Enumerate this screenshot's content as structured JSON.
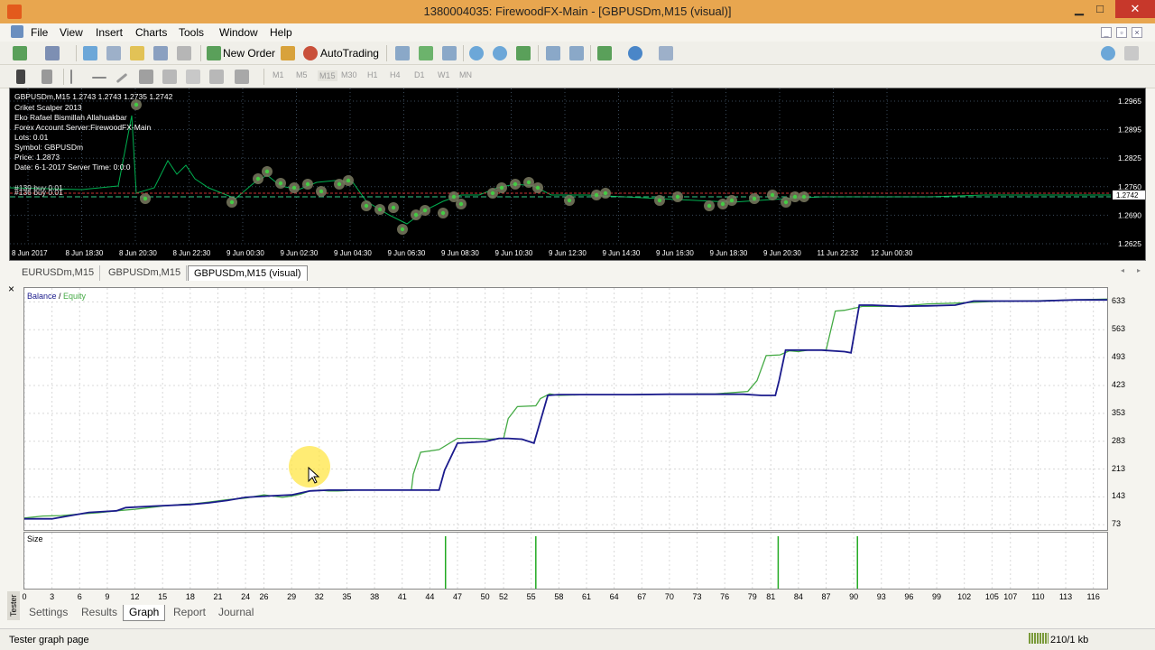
{
  "window": {
    "title": "1380004035: FirewoodFX-Main - [GBPUSDm,M15 (visual)]",
    "minimize": "▁",
    "maximize": "□",
    "close": "✕"
  },
  "menu": [
    "File",
    "View",
    "Insert",
    "Charts",
    "Tools",
    "Window",
    "Help"
  ],
  "toolbar": {
    "new_order": "New Order",
    "autotrading": "AutoTrading",
    "timeframes": [
      "M1",
      "M5",
      "M15",
      "M30",
      "H1",
      "H4",
      "D1",
      "W1",
      "MN"
    ]
  },
  "chart": {
    "header": "GBPUSDm,M15  1.2743 1.2743 1.2735 1.2742",
    "info_lines": [
      "Criket Scalper 2013",
      "Eko Rafael  Bismillah Allahuakbar",
      "Forex Account Server:FirewoodFX-Main",
      "Lots:  0.01",
      "Symbol: GBPUSDm",
      "Price:  1.2873",
      "Date: 6-1-2017  Server Time: 0:0:0"
    ],
    "order_labels": [
      "#139 buy 0.01",
      "#136 buy 0.01"
    ],
    "price_ticks": [
      "1.2965",
      "1.2895",
      "1.2825",
      "1.2760",
      "1.2690",
      "1.2625"
    ],
    "current_price": "1.2742",
    "time_ticks": [
      "8 Jun 2017",
      "8 Jun 18:30",
      "8 Jun 20:30",
      "8 Jun 22:30",
      "9 Jun 00:30",
      "9 Jun 02:30",
      "9 Jun 04:30",
      "9 Jun 06:30",
      "9 Jun 08:30",
      "9 Jun 10:30",
      "9 Jun 12:30",
      "9 Jun 14:30",
      "9 Jun 16:30",
      "9 Jun 18:30",
      "9 Jun 20:30",
      "11 Jun 22:32",
      "12 Jun 00:30"
    ],
    "colors": {
      "background": "#000000",
      "up_line": "#00b050",
      "grid": "#3a4a5a"
    }
  },
  "chart_tabs": [
    {
      "label": "EURUSDm,M15",
      "active": false
    },
    {
      "label": "GBPUSDm,M15",
      "active": false
    },
    {
      "label": "GBPUSDm,M15 (visual)",
      "active": true
    }
  ],
  "tester": {
    "side_label": "Tester",
    "legend_balance": "Balance",
    "legend_sep": " / ",
    "legend_equity": "Equity",
    "size_label": "Size",
    "tabs": [
      "Settings",
      "Results",
      "Graph",
      "Report",
      "Journal"
    ],
    "active_tab": "Graph",
    "colors": {
      "balance": "#1a1a8c",
      "equity": "#44aa44",
      "size": "#22aa22"
    }
  },
  "chart_data": {
    "type": "line",
    "title": "",
    "xlabel": "",
    "ylabel": "",
    "x_ticks": [
      0,
      3,
      6,
      9,
      12,
      15,
      18,
      21,
      24,
      26,
      29,
      32,
      35,
      38,
      41,
      44,
      47,
      50,
      52,
      55,
      58,
      61,
      64,
      67,
      70,
      73,
      76,
      79,
      81,
      84,
      87,
      90,
      93,
      96,
      99,
      102,
      105,
      107,
      110,
      113,
      116
    ],
    "y_ticks": [
      73,
      143,
      213,
      283,
      353,
      423,
      493,
      563,
      633
    ],
    "xlim": [
      0,
      117.5
    ],
    "ylim": [
      60,
      668
    ],
    "series": [
      {
        "name": "Balance",
        "x": [
          0,
          3,
          5,
          7,
          10,
          11,
          14,
          18,
          20,
          22,
          24,
          27,
          29,
          31,
          33,
          36,
          39,
          42,
          44,
          45,
          45.6,
          47,
          48.5,
          50,
          51.5,
          52.5,
          54,
          55.3,
          56.8,
          58,
          62,
          66,
          70,
          75,
          78,
          80,
          81.5,
          81.9,
          82.6,
          84.5,
          86.5,
          89,
          89.7,
          90.6,
          92,
          95,
          98,
          101,
          103,
          106,
          110,
          114,
          117.5
        ],
        "y": [
          88,
          88,
          96,
          104,
          108,
          116,
          120,
          124,
          128,
          134,
          142,
          146,
          148,
          158,
          160,
          160,
          160,
          160,
          160,
          160,
          210,
          278,
          280,
          282,
          290,
          290,
          288,
          278,
          398,
          400,
          400,
          400,
          401,
          401,
          401,
          398,
          398,
          435,
          512,
          512,
          512,
          508,
          505,
          625,
          625,
          622,
          623,
          625,
          635,
          635,
          635,
          638,
          638
        ]
      },
      {
        "name": "Equity",
        "x": [
          0,
          2,
          4,
          6,
          8,
          10,
          12,
          13.5,
          15,
          17,
          18.5,
          20,
          22,
          24,
          26,
          28,
          29,
          30,
          31,
          32,
          33,
          34,
          36,
          39,
          42,
          42.2,
          43,
          45,
          47,
          49,
          50.5,
          52,
          52.5,
          53.5,
          55.5,
          56,
          57,
          58,
          61,
          66,
          70,
          75,
          78.5,
          79.5,
          80.5,
          82,
          83,
          84,
          85,
          87,
          88,
          89,
          91,
          95,
          98,
          101,
          105,
          110,
          114,
          117.5
        ],
        "y": [
          90,
          95,
          96,
          100,
          103,
          108,
          112,
          116,
          120,
          124,
          126,
          130,
          136,
          140,
          148,
          142,
          145,
          150,
          158,
          160,
          158,
          158,
          160,
          160,
          160,
          200,
          255,
          262,
          290,
          290,
          288,
          290,
          340,
          370,
          372,
          390,
          402,
          398,
          400,
          400,
          401,
          402,
          408,
          435,
          498,
          500,
          510,
          508,
          512,
          512,
          610,
          612,
          622,
          622,
          628,
          630,
          634,
          636,
          638,
          640
        ]
      }
    ],
    "size_bars_x": [
      45.7,
      55.5,
      81.8,
      90.4
    ]
  },
  "status": {
    "text": "Tester graph page",
    "connection": "210/1 kb"
  }
}
